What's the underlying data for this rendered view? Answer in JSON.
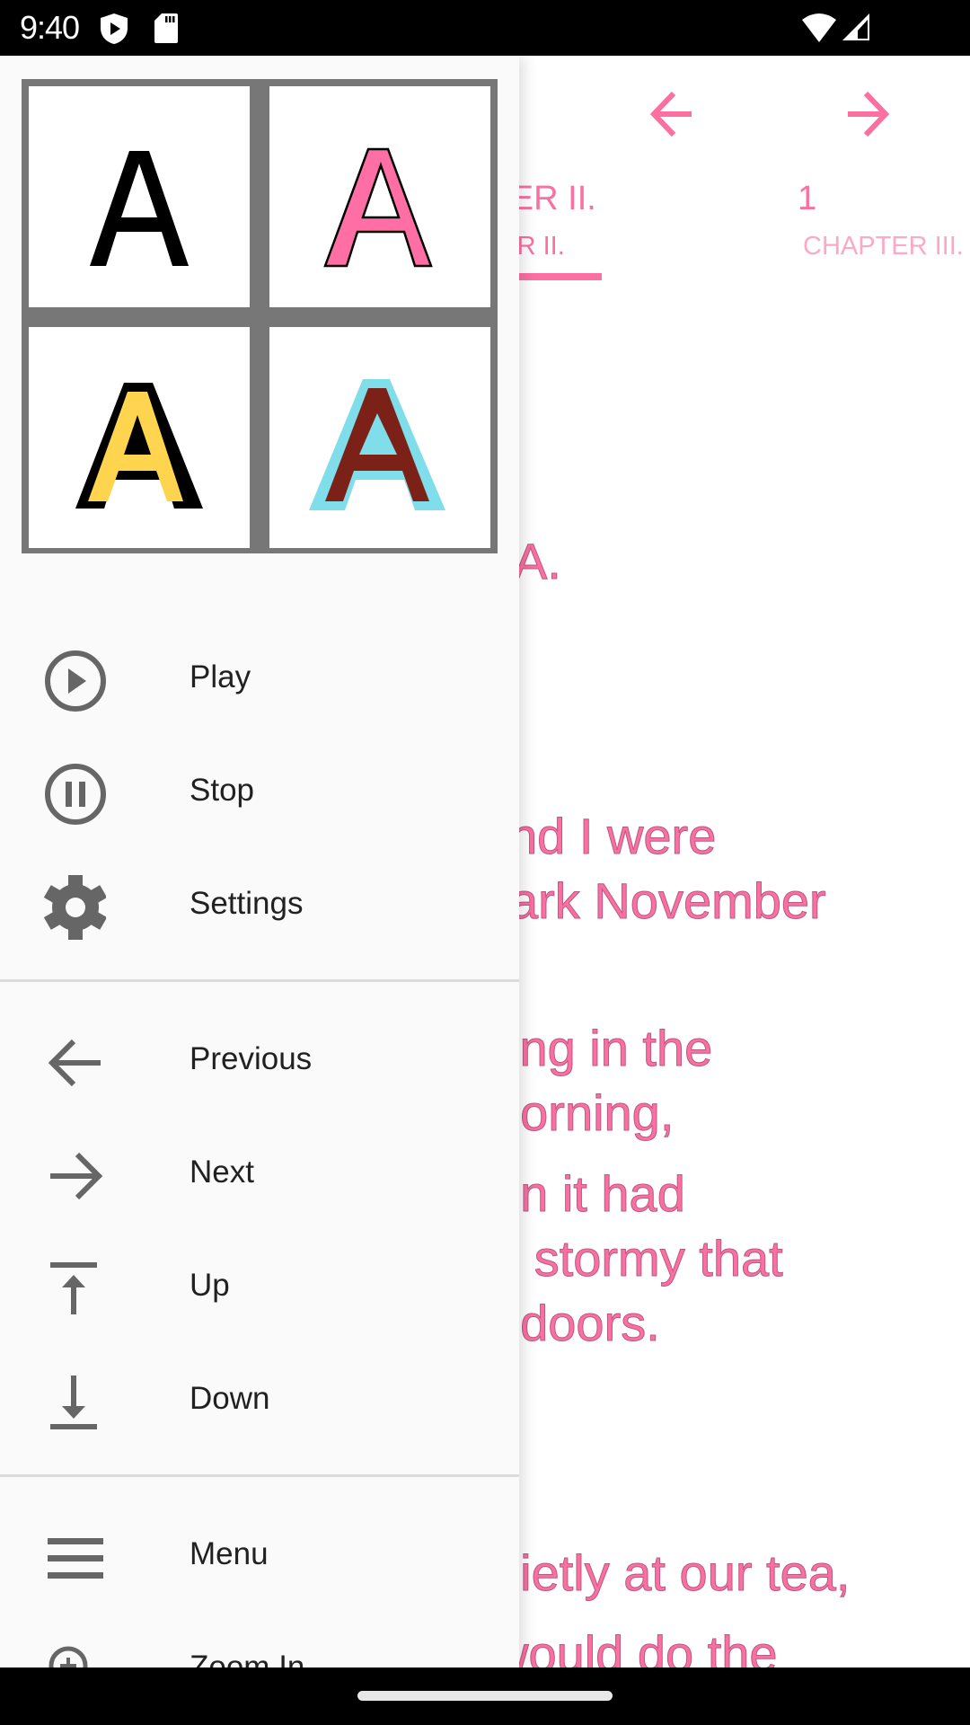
{
  "status_bar": {
    "time": "9:40",
    "icons": [
      "shield-play-icon",
      "sd-card-icon",
      "wifi-icon",
      "cell-signal-icon"
    ]
  },
  "reader": {
    "nav": {
      "prev_icon": "arrow-left-icon",
      "next_icon": "arrow-right-icon"
    },
    "tabs": [
      {
        "title": "CHAPTER II.",
        "subtitle": "CHAPTER II.",
        "selected": true
      },
      {
        "title": "1",
        "subtitle": "CHAPTER III.",
        "selected": false
      }
    ],
    "visible_title_fragment": "A.",
    "text_lines": [
      "nd I were",
      "ark November",
      "ing in the",
      "norning,",
      "on it had",
      "d stormy that",
      "ndoors.",
      "uietly at our tea,",
      "would do the"
    ],
    "accent_color": "#fb6fa1"
  },
  "drawer": {
    "logo": {
      "name": "font-style-grid",
      "glyph": "A",
      "variants": [
        {
          "fill": "#000000",
          "stroke": "none",
          "label": "black"
        },
        {
          "fill": "#ff6fa5",
          "stroke": "#000000",
          "label": "pink-outlined"
        },
        {
          "fill": "#ffd54f",
          "stroke": "#000000",
          "label": "yellow-black-outline"
        },
        {
          "fill": "#7b2118",
          "stroke": "#80deea",
          "label": "maroon-cyan-outline"
        }
      ]
    },
    "sections": [
      {
        "items": [
          {
            "label": "Play",
            "icon": "play-circle-icon"
          },
          {
            "label": "Stop",
            "icon": "pause-circle-icon"
          },
          {
            "label": "Settings",
            "icon": "gear-icon"
          }
        ]
      },
      {
        "items": [
          {
            "label": "Previous",
            "icon": "arrow-left-icon"
          },
          {
            "label": "Next",
            "icon": "arrow-right-icon"
          },
          {
            "label": "Up",
            "icon": "arrow-up-to-top-icon"
          },
          {
            "label": "Down",
            "icon": "arrow-down-to-bottom-icon"
          }
        ]
      },
      {
        "items": [
          {
            "label": "Menu",
            "icon": "menu-icon"
          },
          {
            "label": "Zoom In",
            "icon": "zoom-in-icon"
          }
        ]
      }
    ]
  }
}
